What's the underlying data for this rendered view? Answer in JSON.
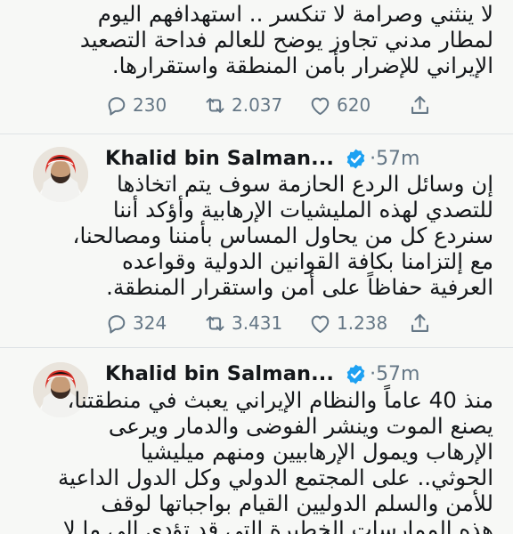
{
  "colors": {
    "text": "#14171a",
    "secondary": "#657786",
    "verified": "#1da1f2",
    "background": "#f7f8f6"
  },
  "tweets": [
    {
      "body_lines": [
        "لا ينثني وصرامة لا تنكسر .. استهدافهم اليوم",
        "لمطار مدني تجاوز يوضح للعالم فداحة التصعيد",
        "الإيراني للإضرار بأمن المنطقة واستقرارها."
      ],
      "reply_count": "230",
      "retweet_count": "2.037",
      "like_count": "620",
      "icons": [
        "reply-icon",
        "retweet-icon",
        "like-icon",
        "share-icon"
      ]
    },
    {
      "author": "Khalid bin Salman...",
      "verified": true,
      "separator": "·",
      "time": "57m",
      "body_lines": [
        "إن وسائل الردع الحازمة سوف يتم اتخاذها",
        "للتصدي لهذه المليشيات الإرهابية وأؤكد أننا",
        "سنردع كل من يحاول المساس بأمننا ومصالحنا،",
        "مع إلتزامنا بكافة القوانين الدولية وقواعده",
        "العرفية حفاظاً على أمن واستقرار المنطقة."
      ],
      "reply_count": "324",
      "retweet_count": "3.431",
      "like_count": "1.238",
      "icons": [
        "reply-icon",
        "retweet-icon",
        "like-icon",
        "share-icon"
      ]
    },
    {
      "author": "Khalid bin Salman...",
      "verified": true,
      "separator": "·",
      "time": "57m",
      "body_lines": [
        "منذ 40 عاماً والنظام الإيراني يعبث في منطقتنا،",
        "يصنع الموت وينشر الفوضى والدمار ويرعى",
        "الإرهاب ويمول الإرهابيين ومنهم ميليشيا",
        "الحوثي.. على المجتمع الدولي وكل الدول الداعية",
        "للأمن والسلم الدوليين القيام بواجباتها لوقف",
        "هذه الممارسات الخطيرة التي قد تؤدي إلى ما لا"
      ]
    }
  ]
}
